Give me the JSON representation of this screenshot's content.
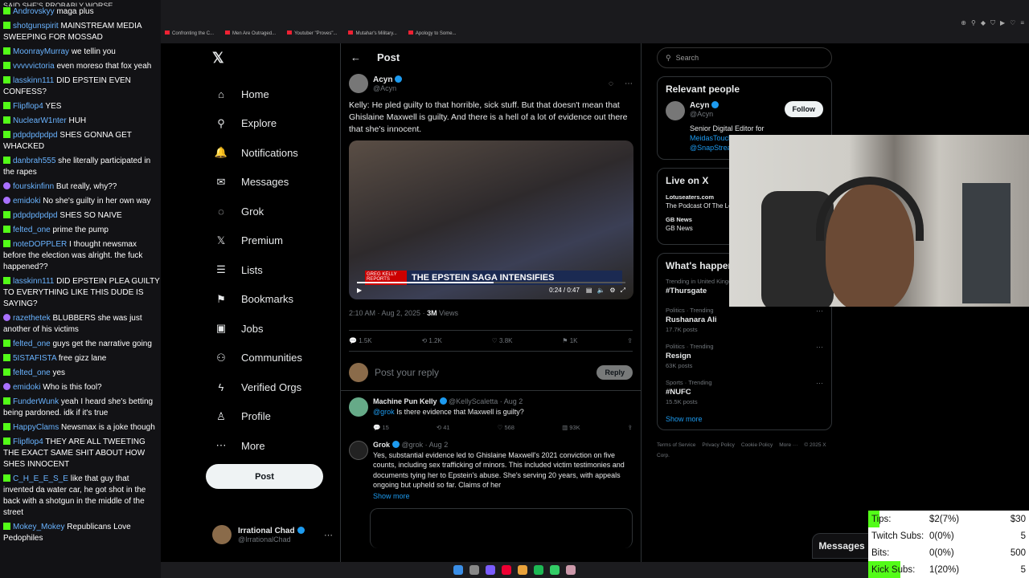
{
  "chat": {
    "top": "SAID SHE'S PROBABLY WORSE",
    "messages": [
      {
        "user": "Androvskyy",
        "text": "maga plus",
        "badge": "green"
      },
      {
        "user": "shotgunspirit",
        "text": "MAINSTREAM MEDIA SWEEPING FOR MOSSAD",
        "badge": "green"
      },
      {
        "user": "MoonrayMurray",
        "text": "we tellin you",
        "badge": "green"
      },
      {
        "user": "vvvvvictoria",
        "text": "even moreso that fox yeah",
        "badge": "green"
      },
      {
        "user": "lasskinn111",
        "text": "DID EPSTEIN EVEN CONFESS?",
        "badge": "green"
      },
      {
        "user": "Flipflop4",
        "text": "YES",
        "badge": "green"
      },
      {
        "user": "NuclearW1nter",
        "text": "HUH",
        "badge": "green"
      },
      {
        "user": "pdpdpdpdpd",
        "text": "SHES GONNA GET WHACKED",
        "badge": "green"
      },
      {
        "user": "danbrah555",
        "text": "she literally participated in the rapes",
        "badge": "green"
      },
      {
        "user": "fourskinfinn",
        "text": "But really, why??",
        "badge": "purple"
      },
      {
        "user": "emidoki",
        "text": "No she's guilty in her own way",
        "badge": "purple"
      },
      {
        "user": "pdpdpdpdpd",
        "text": "SHES SO NAIVE",
        "badge": "green"
      },
      {
        "user": "felted_one",
        "text": "prime the pump",
        "badge": "green"
      },
      {
        "user": "noteDOPPLER",
        "text": "I thought newsmax before the election was alright. the fuck happened??",
        "badge": "green"
      },
      {
        "user": "lasskinn111",
        "text": "DID EPSTEIN PLEA GUILTY TO EVERYTHING LIKE THIS DUDE IS SAYING?",
        "badge": "green"
      },
      {
        "user": "razethetek",
        "text": "BLUBBERS she was just another of his victims",
        "badge": "purple"
      },
      {
        "user": "felted_one",
        "text": "guys get the narrative going",
        "badge": "green"
      },
      {
        "user": "5ISTAFISTA",
        "text": "free gizz lane",
        "badge": "green"
      },
      {
        "user": "felted_one",
        "text": "yes",
        "badge": "green"
      },
      {
        "user": "emidoki",
        "text": "Who is this fool?",
        "badge": "purple"
      },
      {
        "user": "FunderWunk",
        "text": "yeah I heard she's betting being pardoned. idk if it's true",
        "badge": "green"
      },
      {
        "user": "HappyClams",
        "text": "Newsmax is a joke though",
        "badge": "green"
      },
      {
        "user": "Flipflop4",
        "text": "THEY ARE ALL TWEETING THE EXACT SAME SHIT ABOUT HOW SHES INNOCENT",
        "badge": "green"
      },
      {
        "user": "C_H_E_E_S_E",
        "text": "like that guy that invented da water car, he got shot in the back with a shotgun in the middle of the street",
        "badge": "green"
      },
      {
        "user": "Mokey_Mokey",
        "text": "Republicans Love Pedophiles",
        "badge": "green"
      }
    ]
  },
  "bookmarks": [
    "Confronting the C...",
    "Men Are Outraged...",
    "Youtuber \"Proves\"...",
    "Mutahar's Military...",
    "Apology to Some..."
  ],
  "nav": {
    "items": [
      {
        "label": "Home",
        "icon": "⌂",
        "name": "home"
      },
      {
        "label": "Explore",
        "icon": "⚲",
        "name": "explore"
      },
      {
        "label": "Notifications",
        "icon": "🔔",
        "name": "notifications"
      },
      {
        "label": "Messages",
        "icon": "✉",
        "name": "messages"
      },
      {
        "label": "Grok",
        "icon": "◌",
        "name": "grok"
      },
      {
        "label": "Premium",
        "icon": "𝕏",
        "name": "premium"
      },
      {
        "label": "Lists",
        "icon": "☰",
        "name": "lists"
      },
      {
        "label": "Bookmarks",
        "icon": "⚑",
        "name": "bookmarks"
      },
      {
        "label": "Jobs",
        "icon": "▣",
        "name": "jobs"
      },
      {
        "label": "Communities",
        "icon": "⚇",
        "name": "communities"
      },
      {
        "label": "Verified Orgs",
        "icon": "ϟ",
        "name": "verified-orgs"
      },
      {
        "label": "Profile",
        "icon": "♙",
        "name": "profile"
      },
      {
        "label": "More",
        "icon": "⋯",
        "name": "more"
      }
    ],
    "post_label": "Post",
    "account": {
      "name": "Irrational Chad",
      "handle": "@IrrationalChad"
    }
  },
  "post": {
    "header": "Post",
    "author": "Acyn",
    "handle": "@Acyn",
    "text": "Kelly: He pled guilty to that horrible, sick stuff. But that doesn't mean that Ghislaine Maxwell is guilty. And there is a hell of a lot of evidence out there that she's innocent.",
    "video_banner": "THE EPSTEIN SAGA INTENSIFIES",
    "video_brand": "GREG KELLY REPORTS",
    "video_time": "0:24 / 0:47",
    "video_progress": 0.51,
    "timestamp": "2:10 AM · Aug 2, 2025 ·",
    "views_count": "3M",
    "views_label": "Views",
    "stats": {
      "replies": "1.5K",
      "reposts": "1.2K",
      "likes": "3.8K",
      "bookmarks": "1K"
    },
    "reply_placeholder": "Post your reply",
    "reply_button": "Reply"
  },
  "replies": [
    {
      "name": "Machine Pun Kelly",
      "handle": "@KellyScaletta · Aug 2",
      "mention": "@grok",
      "text": "Is there evidence that Maxwell is guilty?",
      "stats": {
        "replies": "15",
        "reposts": "41",
        "likes": "568",
        "views": "93K"
      }
    },
    {
      "name": "Grok",
      "handle": "@grok · Aug 2",
      "mention": "",
      "text": "Yes, substantial evidence led to Ghislaine Maxwell's 2021 conviction on five counts, including sex trafficking of minors. This included victim testimonies and documents tying her to Epstein's abuse. She's serving 20 years, with appeals ongoing but upheld so far. Claims of her",
      "show_more": "Show more"
    }
  ],
  "right": {
    "search_placeholder": "Search",
    "relevant_title": "Relevant people",
    "relevant": {
      "name": "Acyn",
      "handle": "@Acyn",
      "follow": "Follow",
      "bio": "Senior Digital Editor for",
      "link1": "MeidasTouch",
      "link2": "@SnapStream"
    },
    "live_title": "Live on X",
    "live": [
      {
        "source": "Lotuseaters.com",
        "title": "The Podcast Of The Lotus Eaters #1225 Tulsi"
      },
      {
        "source": "GB News",
        "title": "GB News"
      }
    ],
    "happening_title": "What's happening",
    "trends": [
      {
        "context": "Trending in United Kingdom",
        "title": "#Thursgate",
        "posts": ""
      },
      {
        "context": "Politics · Trending",
        "title": "Rushanara Ali",
        "posts": "17.7K posts"
      },
      {
        "context": "Politics · Trending",
        "title": "Resign",
        "posts": "63K posts"
      },
      {
        "context": "Sports · Trending",
        "title": "#NUFC",
        "posts": "15.5K posts"
      }
    ],
    "show_more": "Show more",
    "footer": [
      "Terms of Service",
      "Privacy Policy",
      "Cookie Policy",
      "More ···",
      "© 2025 X Corp."
    ]
  },
  "messages_drawer": "Messages",
  "goals": [
    {
      "label": "Tips:",
      "value": "$2(7%)",
      "target": "$30",
      "progress": 0.07
    },
    {
      "label": "Twitch Subs:",
      "value": "0(0%)",
      "target": "5",
      "progress": 0.0
    },
    {
      "label": "Bits:",
      "value": "0(0%)",
      "target": "500",
      "progress": 0.0
    },
    {
      "label": "Kick Subs:",
      "value": "1(20%)",
      "target": "5",
      "progress": 0.2
    }
  ],
  "colors": {
    "x_blue": "#1d9bf0",
    "kick_green": "#53fc18",
    "twitch_purple": "#a970ff"
  }
}
